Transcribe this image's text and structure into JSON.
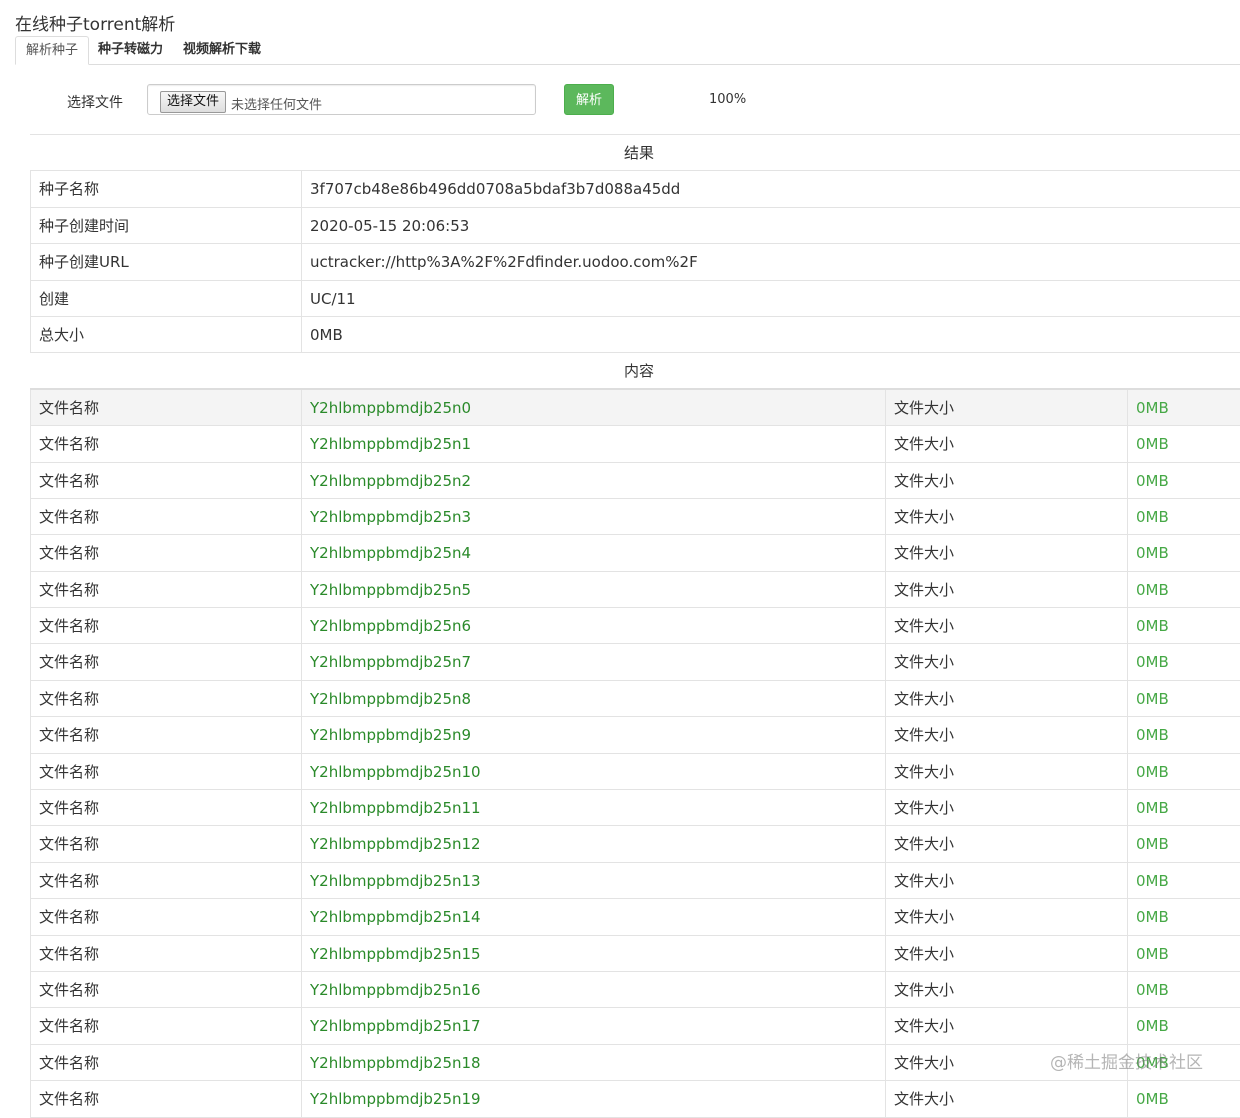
{
  "page": {
    "title": "在线种子torrent解析"
  },
  "tabs": [
    {
      "label": "解析种子",
      "active": true
    },
    {
      "label": "种子转磁力",
      "active": false
    },
    {
      "label": "视频解析下载",
      "active": false
    }
  ],
  "form": {
    "file_label": "选择文件",
    "file_button": "选择文件",
    "file_status": "未选择任何文件",
    "parse_button": "解析",
    "progress": "100%"
  },
  "result": {
    "heading": "结果",
    "info": [
      {
        "label": "种子名称",
        "value": "3f707cb48e86b496dd0708a5bdaf3b7d088a45dd"
      },
      {
        "label": "种子创建时间",
        "value": "2020-05-15 20:06:53"
      },
      {
        "label": "种子创建URL",
        "value": "uctracker://http%3A%2F%2Fdfinder.uodoo.com%2F"
      },
      {
        "label": "创建",
        "value": "UC/11"
      },
      {
        "label": "总大小",
        "value": "0MB"
      }
    ],
    "content_heading": "内容",
    "files": [
      {
        "name_label": "文件名称",
        "name": "Y2hlbmppbmdjb25n0",
        "size_label": "文件大小",
        "size": "0MB"
      },
      {
        "name_label": "文件名称",
        "name": "Y2hlbmppbmdjb25n1",
        "size_label": "文件大小",
        "size": "0MB"
      },
      {
        "name_label": "文件名称",
        "name": "Y2hlbmppbmdjb25n2",
        "size_label": "文件大小",
        "size": "0MB"
      },
      {
        "name_label": "文件名称",
        "name": "Y2hlbmppbmdjb25n3",
        "size_label": "文件大小",
        "size": "0MB"
      },
      {
        "name_label": "文件名称",
        "name": "Y2hlbmppbmdjb25n4",
        "size_label": "文件大小",
        "size": "0MB"
      },
      {
        "name_label": "文件名称",
        "name": "Y2hlbmppbmdjb25n5",
        "size_label": "文件大小",
        "size": "0MB"
      },
      {
        "name_label": "文件名称",
        "name": "Y2hlbmppbmdjb25n6",
        "size_label": "文件大小",
        "size": "0MB"
      },
      {
        "name_label": "文件名称",
        "name": "Y2hlbmppbmdjb25n7",
        "size_label": "文件大小",
        "size": "0MB"
      },
      {
        "name_label": "文件名称",
        "name": "Y2hlbmppbmdjb25n8",
        "size_label": "文件大小",
        "size": "0MB"
      },
      {
        "name_label": "文件名称",
        "name": "Y2hlbmppbmdjb25n9",
        "size_label": "文件大小",
        "size": "0MB"
      },
      {
        "name_label": "文件名称",
        "name": "Y2hlbmppbmdjb25n10",
        "size_label": "文件大小",
        "size": "0MB"
      },
      {
        "name_label": "文件名称",
        "name": "Y2hlbmppbmdjb25n11",
        "size_label": "文件大小",
        "size": "0MB"
      },
      {
        "name_label": "文件名称",
        "name": "Y2hlbmppbmdjb25n12",
        "size_label": "文件大小",
        "size": "0MB"
      },
      {
        "name_label": "文件名称",
        "name": "Y2hlbmppbmdjb25n13",
        "size_label": "文件大小",
        "size": "0MB"
      },
      {
        "name_label": "文件名称",
        "name": "Y2hlbmppbmdjb25n14",
        "size_label": "文件大小",
        "size": "0MB"
      },
      {
        "name_label": "文件名称",
        "name": "Y2hlbmppbmdjb25n15",
        "size_label": "文件大小",
        "size": "0MB"
      },
      {
        "name_label": "文件名称",
        "name": "Y2hlbmppbmdjb25n16",
        "size_label": "文件大小",
        "size": "0MB"
      },
      {
        "name_label": "文件名称",
        "name": "Y2hlbmppbmdjb25n17",
        "size_label": "文件大小",
        "size": "0MB"
      },
      {
        "name_label": "文件名称",
        "name": "Y2hlbmppbmdjb25n18",
        "size_label": "文件大小",
        "size": "0MB"
      },
      {
        "name_label": "文件名称",
        "name": "Y2hlbmppbmdjb25n19",
        "size_label": "文件大小",
        "size": "0MB"
      }
    ]
  },
  "watermark": "@稀土掘金技术社区",
  "colors": {
    "accent_green": "#5cb85c",
    "link_green": "#2a8a2a"
  }
}
